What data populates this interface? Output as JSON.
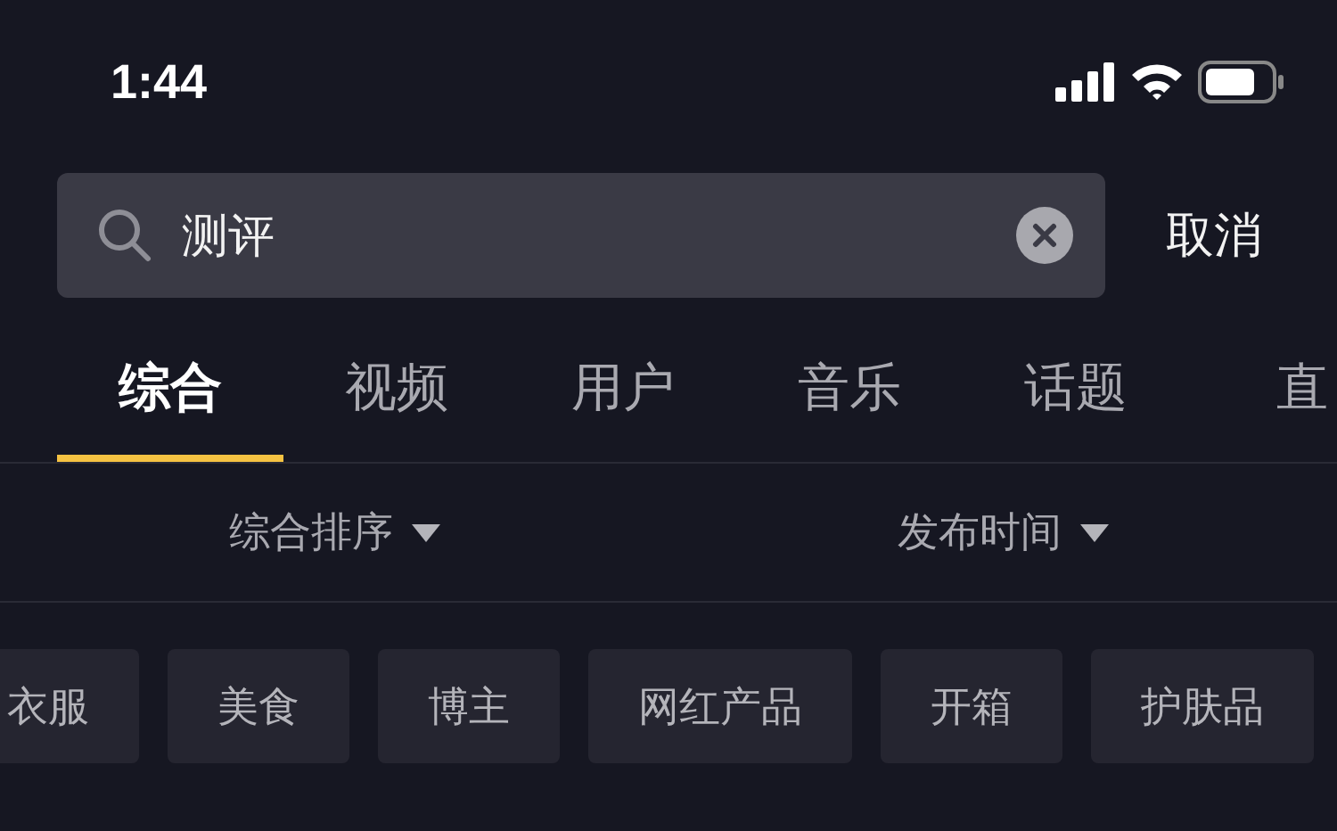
{
  "status_bar": {
    "time": "1:44"
  },
  "search": {
    "value": "测评",
    "cancel": "取消"
  },
  "tabs": [
    {
      "label": "综合",
      "selected": true
    },
    {
      "label": "视频",
      "selected": false
    },
    {
      "label": "用户",
      "selected": false
    },
    {
      "label": "音乐",
      "selected": false
    },
    {
      "label": "话题",
      "selected": false
    },
    {
      "label": "直",
      "selected": false
    }
  ],
  "filters": [
    {
      "label": "综合排序"
    },
    {
      "label": "发布时间"
    }
  ],
  "chips": [
    "衣服",
    "美食",
    "博主",
    "网红产品",
    "开箱",
    "护肤品"
  ]
}
